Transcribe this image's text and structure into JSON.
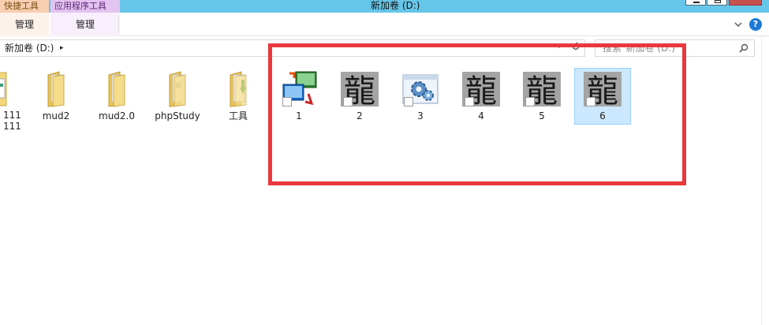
{
  "titlebar": {
    "context_tab_shortcut": "快捷工具",
    "context_tab_app": "应用程序工具",
    "title": "新加卷 (D:)"
  },
  "ribbon": {
    "tab_manage_1": "管理",
    "tab_manage_2": "管理"
  },
  "address": {
    "path": "新加卷 (D:)",
    "breadcrumb_arrow": "▸"
  },
  "search": {
    "placeholder": "搜索\"新加卷 (D:)\""
  },
  "files": [
    {
      "label": "111\n111",
      "type": "folder-partial"
    },
    {
      "label": "mud2",
      "type": "folder"
    },
    {
      "label": "mud2.0",
      "type": "folder"
    },
    {
      "label": "phpStudy",
      "type": "folder"
    },
    {
      "label": "工具",
      "type": "folder"
    },
    {
      "label": "1",
      "type": "remote-desktop-shortcut"
    },
    {
      "label": "2",
      "type": "dragon-shortcut"
    },
    {
      "label": "3",
      "type": "gear-shortcut"
    },
    {
      "label": "4",
      "type": "dragon-shortcut"
    },
    {
      "label": "5",
      "type": "dragon-shortcut"
    },
    {
      "label": "6",
      "type": "dragon-shortcut",
      "selected": true
    }
  ],
  "colors": {
    "titlebar": "#66c6e9",
    "highlight_box": "#e8383d",
    "selection": "#cce8ff",
    "help_button": "#1c79d6"
  },
  "dragon_glyph": "龍"
}
